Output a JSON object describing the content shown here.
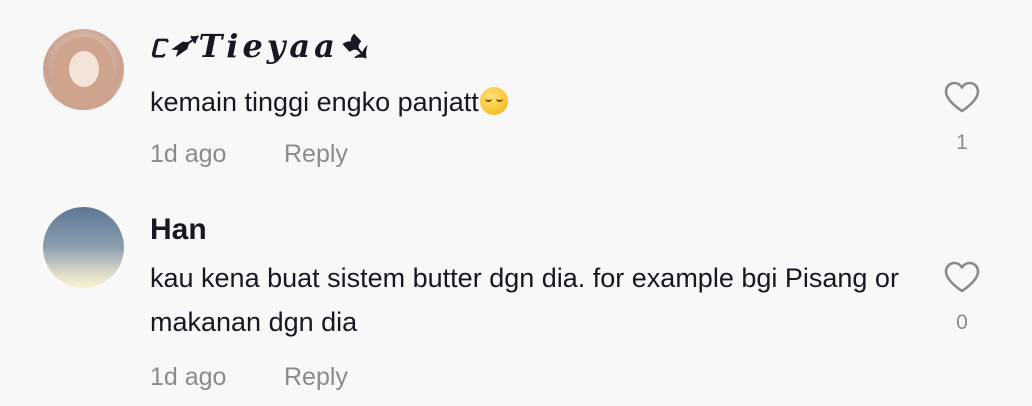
{
  "comments": [
    {
      "username": "ᥴ➶𝑻𝒊𝒆𝒚𝒂𝒂➷",
      "text": "kemain tinggi engko panjatt",
      "emoji": "relieved-face-emoji",
      "time": "1d ago",
      "reply_label": "Reply",
      "like_count": "1"
    },
    {
      "username": "Han",
      "text": "kau kena buat sistem butter dgn dia. for example bgi Pisang or makanan dgn dia",
      "time": "1d ago",
      "reply_label": "Reply",
      "like_count": "0"
    }
  ],
  "icons": {
    "like": "heart-outline-icon"
  },
  "colors": {
    "background": "#f8f8f8",
    "primary_text": "#161823",
    "secondary_text": "#8a8b91"
  }
}
